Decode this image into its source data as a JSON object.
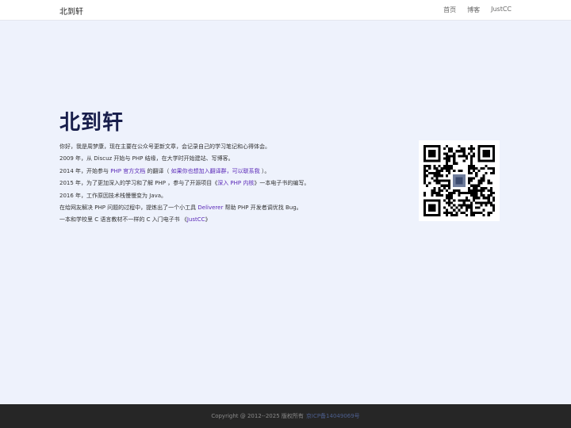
{
  "nav": {
    "brand": "北到轩",
    "links": [
      "首页",
      "博客",
      "JustCC"
    ]
  },
  "hero": {
    "title": "北到轩",
    "lines": [
      {
        "text": "你好，我是周梦康，现在主要在公众号更新文章，会记录自己的学习笔记和心得体会。"
      },
      {
        "text": "2009 年，从 Discuz 开始与 PHP 结缘，在大学时开始建站、写博客。"
      },
      {
        "before": "2014 年，开始参与 ",
        "link1": "PHP 官方文档",
        "mid": " 的翻译（ ",
        "link2": "如果你也想加入翻译群，可以联系我",
        "after": " ）。"
      },
      {
        "before": "2015 年，为了更加深入的学习和了解 PHP ，参与了开源项目《",
        "link1": "深入 PHP 内核",
        "after": "》一本电子书的编写。"
      },
      {
        "text": "2016 年，工作原因技术栈慢慢变为 Java。"
      },
      {
        "before": "在给网友解决 PHP 问题的过程中，提炼出了一个小工具 ",
        "link1": "Deliverer",
        "after": " 帮助 PHP 开发者调优找 Bug。"
      },
      {
        "before": "一本和学校里 C 语言教材不一样的 C 入门电子书 《",
        "link1": "JustCC",
        "after": "》"
      }
    ]
  },
  "footer": {
    "copyright": "Copyright @ 2012--2025 版权所有",
    "icp": "京ICP备14049069号"
  },
  "colors": {
    "background": "#eef2fc",
    "title": "#181e4b",
    "link": "#5b2ab8",
    "footer_bg": "#262626"
  }
}
